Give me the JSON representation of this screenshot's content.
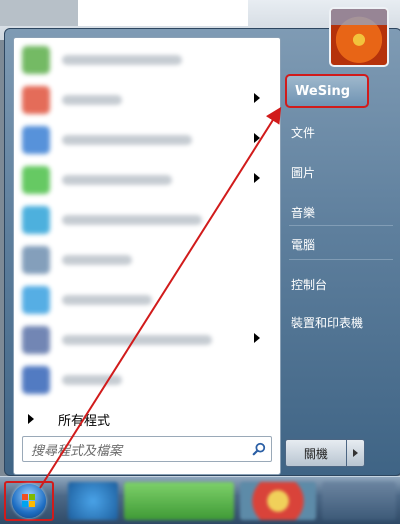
{
  "right_menu": {
    "items": [
      {
        "label": "WeSing"
      },
      {
        "label": "文件"
      },
      {
        "label": "圖片"
      },
      {
        "label": "音樂"
      },
      {
        "label": "電腦"
      },
      {
        "label": "控制台"
      },
      {
        "label": "裝置和印表機"
      }
    ]
  },
  "left_menu": {
    "all_programs": "所有程式",
    "search_placeholder": "搜尋程式及檔案"
  },
  "shutdown": {
    "label": "關機"
  },
  "colors": {
    "highlight_border": "#d11b1b",
    "menu_blue": "#5e7f9d",
    "arrow_red": "#d11b1b"
  },
  "icons": [
    "search-icon",
    "windows-start-orb-icon",
    "user-avatar-flower",
    "ie-icon",
    "folder-icon",
    "chrome-icon"
  ]
}
